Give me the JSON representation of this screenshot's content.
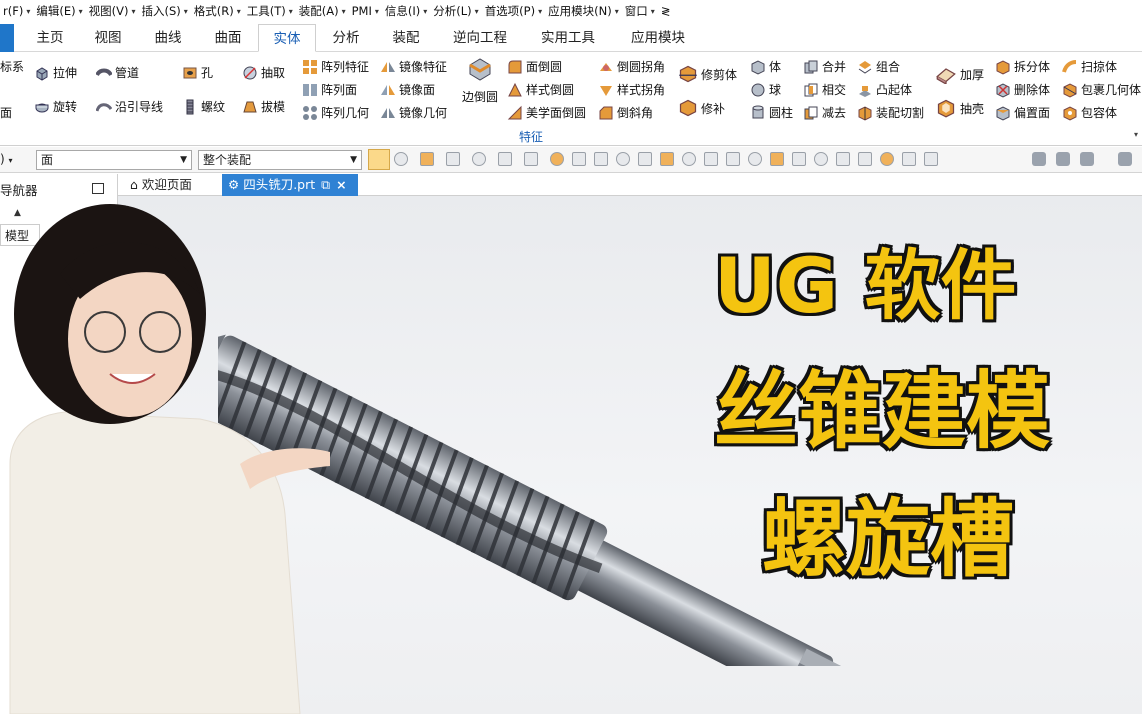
{
  "menubar": {
    "items": [
      {
        "label": "r(F)",
        "dd": "▾"
      },
      {
        "label": "编辑(E)",
        "dd": "▾"
      },
      {
        "label": "视图(V)",
        "dd": "▾"
      },
      {
        "label": "插入(S)",
        "dd": "▾"
      },
      {
        "label": "格式(R)",
        "dd": "▾"
      },
      {
        "label": "工具(T)",
        "dd": "▾"
      },
      {
        "label": "装配(A)",
        "dd": "▾"
      },
      {
        "label": "PMI",
        "dd": "▾"
      },
      {
        "label": "信息(I)",
        "dd": "▾"
      },
      {
        "label": "分析(L)",
        "dd": "▾"
      },
      {
        "label": "首选项(P)",
        "dd": "▾"
      },
      {
        "label": "应用模块(N)",
        "dd": "▾"
      },
      {
        "label": "窗口",
        "dd": "▾"
      },
      {
        "label": "≷",
        "dd": ""
      }
    ]
  },
  "tabs": [
    "主页",
    "视图",
    "曲线",
    "曲面",
    "实体",
    "分析",
    "装配",
    "逆向工程",
    "实用工具",
    "应用模块"
  ],
  "active_tab": "实体",
  "ribbon": {
    "group_label": "特征",
    "left_labels": [
      "标系",
      "面"
    ],
    "items": {
      "extrude": "拉伸",
      "pipe": "管道",
      "hole": "孔",
      "shell_extract": "抽取",
      "revolve": "旋转",
      "sweep_guide": "沿引导线",
      "thread": "螺纹",
      "draft": "拔模",
      "pattern_feature": "阵列特征",
      "mirror_feature": "镜像特征",
      "pattern_face": "阵列面",
      "mirror_face": "镜像面",
      "pattern_geometry": "阵列几何",
      "mirror_geometry": "镜像几何",
      "edge_blend": "边倒圆",
      "face_blend": "面倒圆",
      "style_blend": "样式倒圆",
      "aesthetic_blend": "美学面倒圆",
      "chamfer_corner": "倒圆拐角",
      "style_corner": "样式拐角",
      "chamfer": "倒斜角",
      "trim_body": "修剪体",
      "patch": "修补",
      "body": "体",
      "sphere": "球",
      "cylinder": "圆柱",
      "unite": "合并",
      "intersect": "相交",
      "subtract": "减去",
      "combine": "组合",
      "emboss": "凸起体",
      "assembly_cut": "装配切割",
      "thicken": "加厚",
      "shell": "抽壳",
      "split_body": "拆分体",
      "delete_body": "删除体",
      "offset_face": "偏置面",
      "sweep": "扫掠体",
      "wrap_geometry": "包裹几何体",
      "bounding_body": "包容体"
    }
  },
  "selection_bar": {
    "filter_stub": ")",
    "type_filter": "面",
    "scope_filter": "整个装配"
  },
  "navigator": {
    "title": "导航器",
    "item": "模型"
  },
  "doc_tabs": {
    "welcome": "欢迎页面",
    "file": "四头铣刀.prt"
  },
  "overlay": {
    "line1": "UG  软件",
    "line2": "丝锥建模",
    "line3": "螺旋槽"
  },
  "colors": {
    "accent_blue": "#2f82d4",
    "title_yellow": "#f4c410",
    "title_outline": "#111111"
  }
}
